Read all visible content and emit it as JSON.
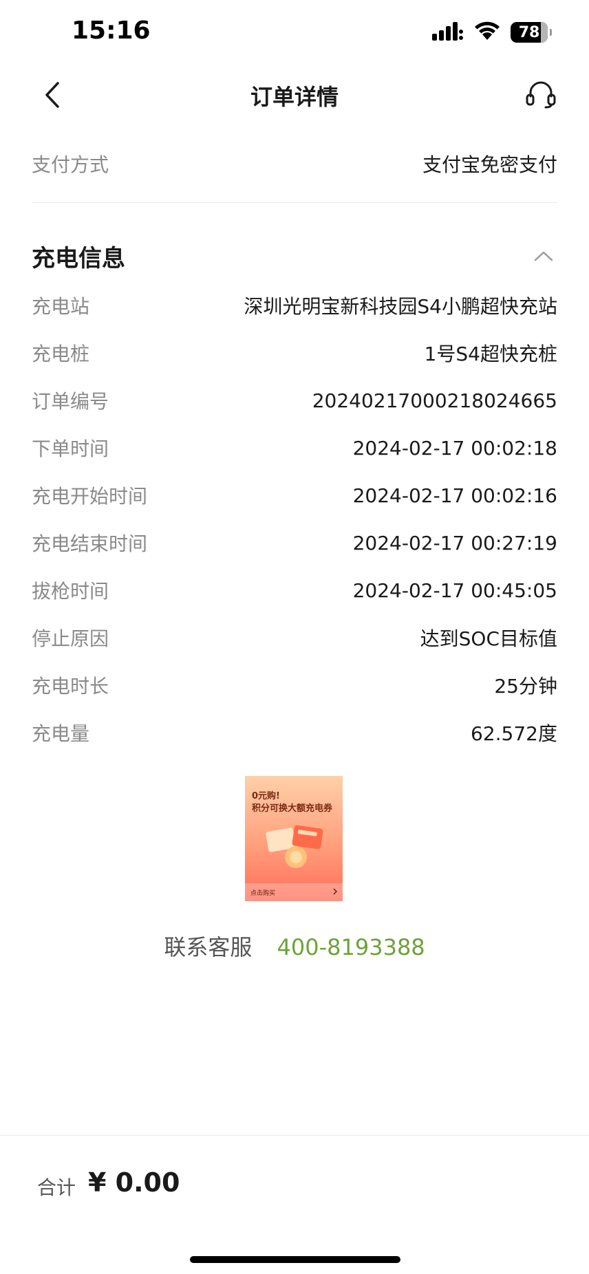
{
  "status_bar": {
    "time": "15:16",
    "battery": "78",
    "icons": [
      "signal-icon",
      "wifi-icon",
      "battery-icon"
    ]
  },
  "nav": {
    "title": "订单详情",
    "back_icon": "chevron-left-icon",
    "service_icon": "headset-icon"
  },
  "payment": {
    "label": "支付方式",
    "value": "支付宝免密支付"
  },
  "charging_info": {
    "title": "充电信息",
    "collapse_icon": "chevron-up-icon",
    "rows": [
      {
        "label": "充电站",
        "value": "深圳光明宝新科技园S4小鹏超快充站"
      },
      {
        "label": "充电桩",
        "value": "1号S4超快充桩"
      },
      {
        "label": "订单编号",
        "value": "20240217000218024665"
      },
      {
        "label": "下单时间",
        "value": "2024-02-17 00:02:18"
      },
      {
        "label": "充电开始时间",
        "value": "2024-02-17 00:02:16"
      },
      {
        "label": "充电结束时间",
        "value": "2024-02-17 00:27:19"
      },
      {
        "label": "拔枪时间",
        "value": "2024-02-17 00:45:05"
      },
      {
        "label": "停止原因",
        "value": "达到SOC目标值"
      },
      {
        "label": "充电时长",
        "value": "25分钟"
      },
      {
        "label": "充电量",
        "value": "62.572度"
      }
    ]
  },
  "promo": {
    "line1": "0元购!",
    "line2": "积分可换大额充电券",
    "footer": "点击购买"
  },
  "contact": {
    "label": "联系客服",
    "phone": "400-8193388"
  },
  "bottom": {
    "total_label": "合计",
    "total_amount": "¥ 0.00"
  },
  "colors": {
    "accent_green": "#6da239",
    "label_gray": "#8a8a8a"
  }
}
